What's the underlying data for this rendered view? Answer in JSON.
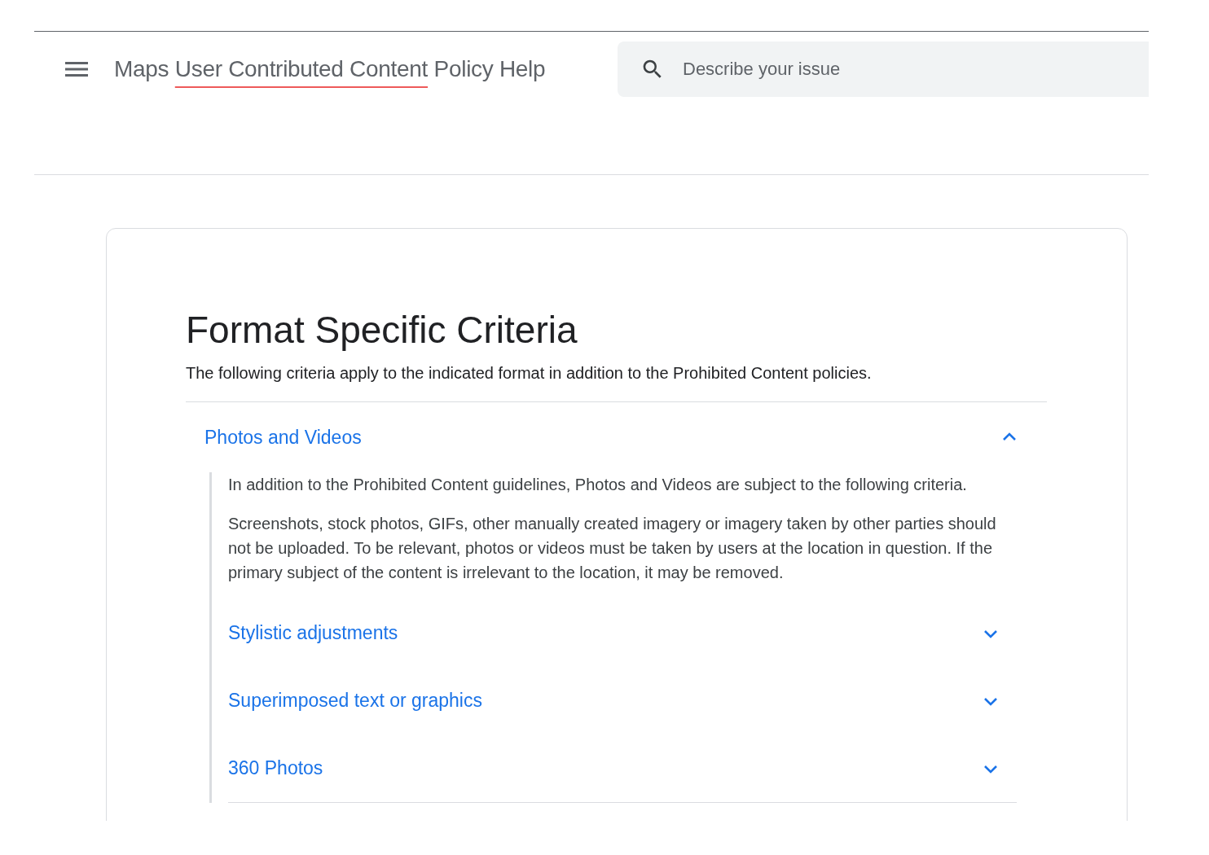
{
  "header": {
    "title": {
      "before": "Maps",
      "marked": "User Contributed Content",
      "after": "Policy Help"
    },
    "search": {
      "placeholder": "Describe your issue"
    }
  },
  "article": {
    "heading": "Format Specific Criteria",
    "intro": "The following criteria apply to the indicated format in addition to the Prohibited Content policies.",
    "sections": [
      {
        "title": "Photos and Videos",
        "expanded": true,
        "paragraphs": [
          "In addition to the Prohibited Content guidelines, Photos and Videos are subject to the following criteria.",
          "Screenshots, stock photos, GIFs, other manually created imagery or imagery taken by other parties should not be uploaded. To be relevant, photos or videos must be taken by users at the location in question. If the primary subject of the content is irrelevant to the location, it may be removed."
        ],
        "subsections": [
          {
            "title": "Stylistic adjustments",
            "expanded": false
          },
          {
            "title": "Superimposed text or graphics",
            "expanded": false
          },
          {
            "title": "360 Photos",
            "expanded": false
          }
        ]
      }
    ]
  }
}
